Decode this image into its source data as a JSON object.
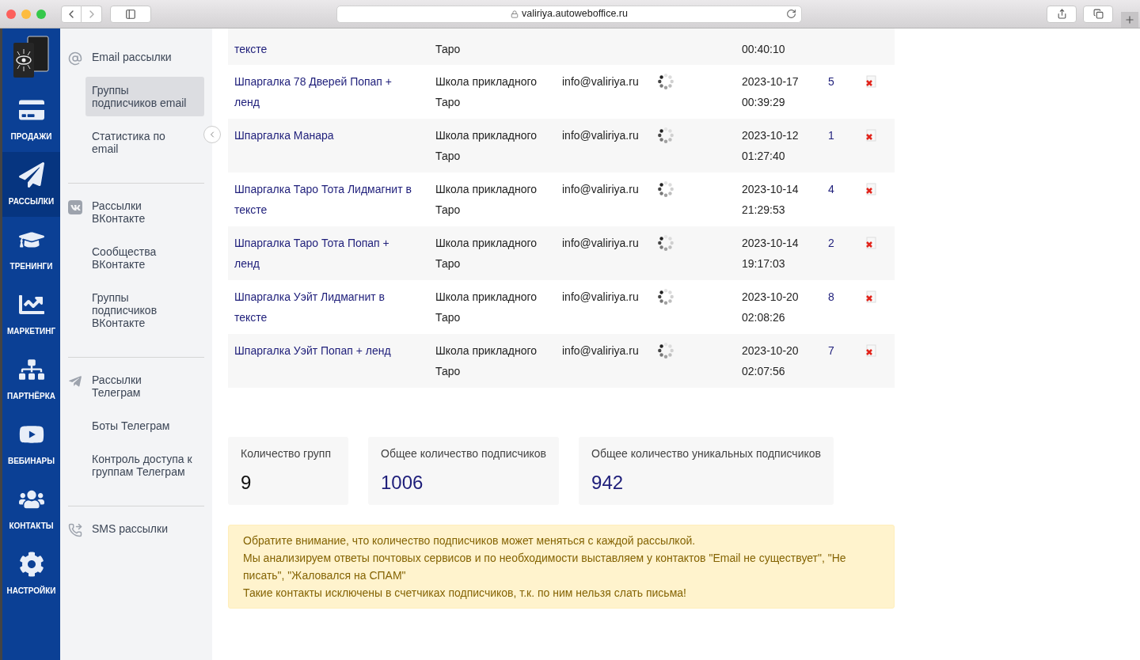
{
  "browser": {
    "url": "valiriya.autoweboffice.ru"
  },
  "nav": [
    {
      "kind": "sales",
      "label": "ПРОДАЖИ",
      "selected": false
    },
    {
      "kind": "mailings",
      "label": "РАССЫЛКИ",
      "selected": true
    },
    {
      "kind": "trainings",
      "label": "ТРЕНИНГИ",
      "selected": false
    },
    {
      "kind": "marketing",
      "label": "МАРКЕТИНГ",
      "selected": false
    },
    {
      "kind": "partners",
      "label": "ПАРТНЁРКА",
      "selected": false
    },
    {
      "kind": "webinars",
      "label": "ВЕБИНАРЫ",
      "selected": false
    },
    {
      "kind": "contacts",
      "label": "КОНТАКТЫ",
      "selected": false
    },
    {
      "kind": "settings",
      "label": "НАСТРОЙКИ",
      "selected": false
    }
  ],
  "menu": [
    {
      "kind": "email",
      "items": [
        {
          "label": "Email рассылки",
          "selected": false
        },
        {
          "label": "Группы\nподписчиков email",
          "selected": true
        },
        {
          "label": "Статистика по\nemail",
          "selected": false
        }
      ]
    },
    {
      "kind": "vk",
      "items": [
        {
          "label": "Рассылки\nВКонтакте",
          "selected": false
        },
        {
          "label": "Сообщества\nВКонтакте",
          "selected": false
        },
        {
          "label": "Группы\nподписчиков\nВКонтакте",
          "selected": false
        }
      ]
    },
    {
      "kind": "telegram",
      "items": [
        {
          "label": "Рассылки\nТелеграм",
          "selected": false
        },
        {
          "label": "Боты Телеграм",
          "selected": false
        },
        {
          "label": "Контроль доступа к\nгруппам Телеграм",
          "selected": false
        }
      ]
    },
    {
      "kind": "sms",
      "items": [
        {
          "label": "SMS рассылки",
          "selected": false
        }
      ]
    }
  ],
  "rows": [
    {
      "name": "тексте",
      "school": "Таро",
      "time": "00:40:10"
    },
    {
      "name": "Шпаргалка 78 Дверей Попап +\nленд",
      "school": "Школа прикладного Таро",
      "email": "info@valiriya.ru",
      "date": "2023-10-17",
      "time": "00:39:29",
      "count": "5"
    },
    {
      "name": "Шпаргалка Манара",
      "school": "Школа прикладного Таро",
      "email": "info@valiriya.ru",
      "date": "2023-10-12",
      "time": "01:27:40",
      "count": "1"
    },
    {
      "name": "Шпаргалка Таро Тота Лидмагнит в\nтексте",
      "school": "Школа прикладного Таро",
      "email": "info@valiriya.ru",
      "date": "2023-10-14",
      "time": "21:29:53",
      "count": "4"
    },
    {
      "name": "Шпаргалка Таро Тота Попап +\nленд",
      "school": "Школа прикладного Таро",
      "email": "info@valiriya.ru",
      "date": "2023-10-14",
      "time": "19:17:03",
      "count": "2"
    },
    {
      "name": "Шпаргалка Уэйт Лидмагнит в\nтексте",
      "school": "Школа прикладного Таро",
      "email": "info@valiriya.ru",
      "date": "2023-10-20",
      "time": "02:08:26",
      "count": "8"
    },
    {
      "name": "Шпаргалка Уэйт Попап + ленд",
      "school": "Школа прикладного Таро",
      "email": "info@valiriya.ru",
      "date": "2023-10-20",
      "time": "02:07:56",
      "count": "7"
    }
  ],
  "stats": [
    {
      "label": "Количество групп",
      "value": "9",
      "kind": "plain"
    },
    {
      "label": "Общее количество подписчиков",
      "value": "1006",
      "kind": "accent"
    },
    {
      "label": "Общее количество уникальных подписчиков",
      "value": "942",
      "kind": "accent"
    }
  ],
  "notice": [
    "Обратите внимание, что количество подписчиков может меняться с каждой рассылкой.",
    "Мы анализируем ответы почтовых сервисов и по необходимости выставляем у контактов \"Email не существует\", \"Не писать\", \"Жаловался на СПАМ\"",
    "Такие контакты исключены в счетчиках подписчиков, т.к. по ним нельзя слать письма!"
  ]
}
